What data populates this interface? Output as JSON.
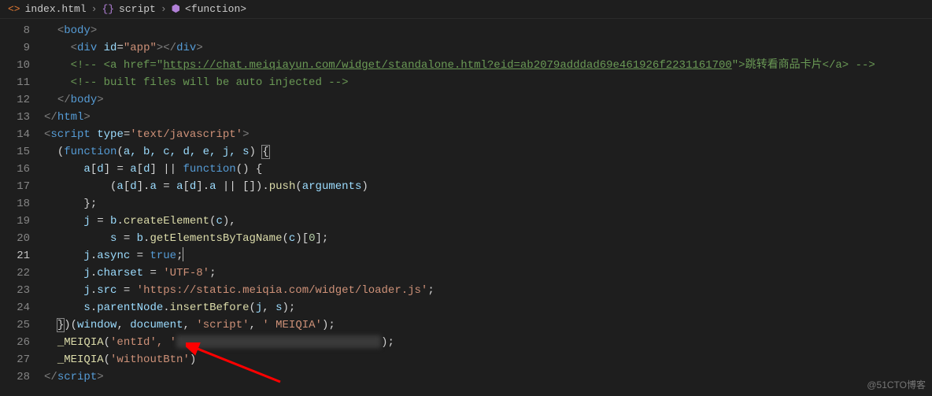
{
  "breadcrumb": {
    "file": "index.html",
    "node1": "script",
    "node2": "<function>"
  },
  "lines": {
    "start": 8,
    "current": 21
  },
  "code": {
    "l8": {
      "t1": "<",
      "t2": "body",
      "t3": ">"
    },
    "l9": {
      "t1": "<",
      "t2": "div",
      "a1": "id",
      "v1": "\"app\"",
      "t3": "></",
      "t4": "div",
      "t5": ">"
    },
    "l10": {
      "c1": "<!-- <a href=\"",
      "url": "https://chat.meiqiayun.com/widget/standalone.html?eid=ab2079adddad69e461926f2231161700",
      "c2": "\">跳转看商品卡片</a> -->"
    },
    "l11": {
      "c": "<!-- built files will be auto injected -->"
    },
    "l12": {
      "t1": "</",
      "t2": "body",
      "t3": ">"
    },
    "l13": {
      "t1": "</",
      "t2": "html",
      "t3": ">"
    },
    "l14": {
      "t1": "<",
      "t2": "script",
      "a1": "type",
      "v1": "'text/javascript'",
      "t3": ">"
    },
    "l15": {
      "p1": "(",
      "kw": "function",
      "p2": "(",
      "args": "a, b, c, d, e, j, s",
      "p3": ") ",
      "br": "{"
    },
    "l16": {
      "v1": "a",
      "p1": "[",
      "v2": "d",
      "p2": "] = ",
      "v3": "a",
      "p3": "[",
      "v4": "d",
      "p4": "] || ",
      "kw": "function",
      "p5": "() {"
    },
    "l17": {
      "p1": "(",
      "v1": "a",
      "p2": "[",
      "v2": "d",
      "p3": "].",
      "v3": "a",
      "p4": " = ",
      "v4": "a",
      "p5": "[",
      "v5": "d",
      "p6": "].",
      "v6": "a",
      "p7": " || []).",
      "fn": "push",
      "p8": "(",
      "v7": "arguments",
      "p9": ")"
    },
    "l18": {
      "p": "};"
    },
    "l19": {
      "v1": "j",
      "p1": " = ",
      "v2": "b",
      "p2": ".",
      "fn": "createElement",
      "p3": "(",
      "v3": "c",
      "p4": "),"
    },
    "l20": {
      "v1": "s",
      "p1": " = ",
      "v2": "b",
      "p2": ".",
      "fn": "getElementsByTagName",
      "p3": "(",
      "v3": "c",
      "p4": ")[",
      "n": "0",
      "p5": "];"
    },
    "l21": {
      "v1": "j",
      "p1": ".",
      "v2": "async",
      "p2": " = ",
      "kw": "true",
      "p3": ";"
    },
    "l22": {
      "v1": "j",
      "p1": ".",
      "v2": "charset",
      "p2": " = ",
      "s": "'UTF-8'",
      "p3": ";"
    },
    "l23": {
      "v1": "j",
      "p1": ".",
      "v2": "src",
      "p2": " = ",
      "s": "'https://static.meiqia.com/widget/loader.js'",
      "p3": ";"
    },
    "l24": {
      "v1": "s",
      "p1": ".",
      "v2": "parentNode",
      "p2": ".",
      "fn": "insertBefore",
      "p3": "(",
      "v3": "j",
      "p4": ", ",
      "v4": "s",
      "p5": ");"
    },
    "l25": {
      "b1": "}",
      "p1": ")(",
      "v1": "window",
      "p2": ", ",
      "v2": "document",
      "p3": ", ",
      "s1": "'script'",
      "p4": ", ",
      "s2": "' MEIQIA'",
      "p5": ");"
    },
    "l26": {
      "fn": "_MEIQIA",
      "p1": "(",
      "s": "'entId'",
      "p2": ", '",
      "p3": ");"
    },
    "l27": {
      "fn": "_MEIQIA",
      "p1": "(",
      "s": "'withoutBtn'",
      "p2": ")"
    },
    "l28": {
      "t1": "</",
      "t2": "script",
      "t3": ">"
    }
  },
  "watermark": "@51CTO博客"
}
